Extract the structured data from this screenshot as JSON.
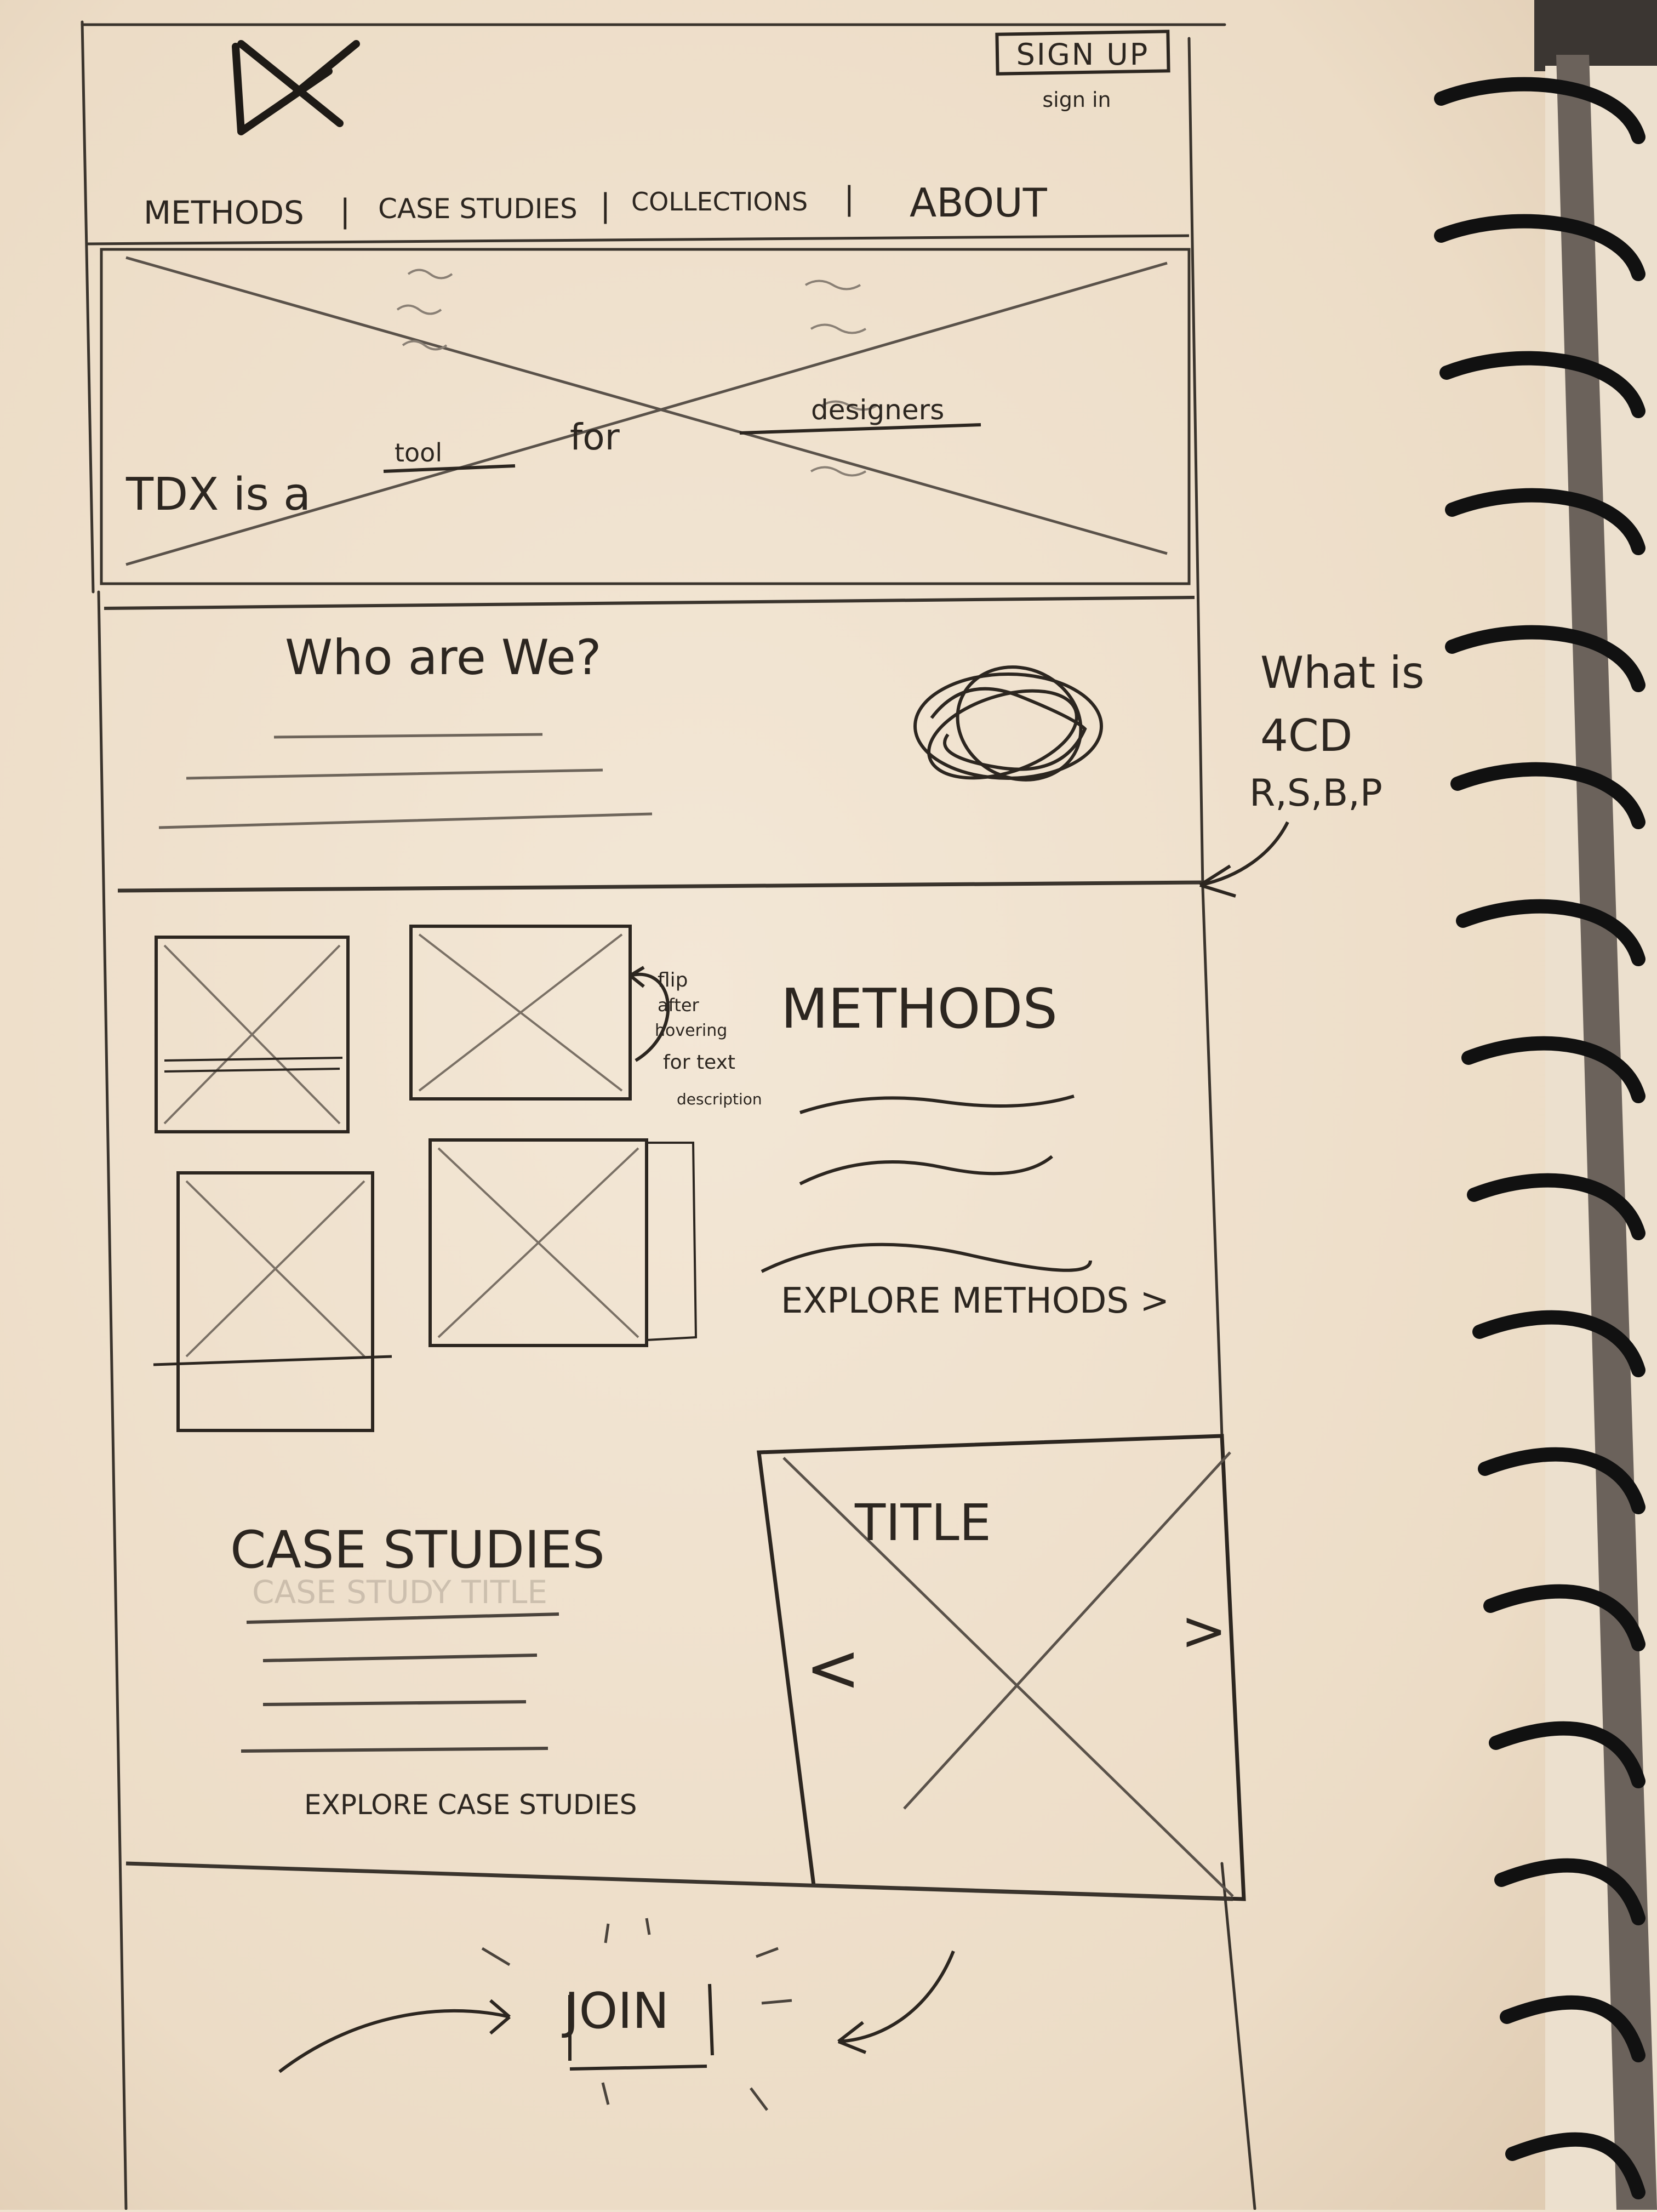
{
  "header": {
    "logo": "DX",
    "signup_label": "SIGN UP",
    "signin_label": "sign in"
  },
  "nav": {
    "items": [
      "METHODS",
      "CASE STUDIES",
      "COLLECTIONS",
      "ABOUT"
    ]
  },
  "hero": {
    "tagline_prefix": "TDX is a",
    "tagline_blank1": "tool",
    "tagline_for": "for",
    "tagline_blank2": "designers"
  },
  "about": {
    "heading": "Who are We?"
  },
  "side_note": {
    "line1": "What is",
    "line2": "4CD",
    "line3": "R,S,B,P"
  },
  "methods": {
    "heading": "METHODS",
    "card_note": [
      "flip",
      "after",
      "hovering",
      "for text",
      "description"
    ],
    "explore_label": "EXPLORE METHODS >"
  },
  "case_studies": {
    "heading": "CASE STUDIES",
    "faint_subtitle": "CASE STUDY TITLE",
    "carousel_title": "TITLE",
    "prev_label": "<",
    "next_label": ">",
    "explore_label": "EXPLORE CASE STUDIES"
  },
  "join": {
    "label": "JOIN"
  },
  "colors": {
    "paper": "#efe2cf",
    "pencil": "#3a342d",
    "spiral": "#111111",
    "desk": "#3b3632"
  }
}
